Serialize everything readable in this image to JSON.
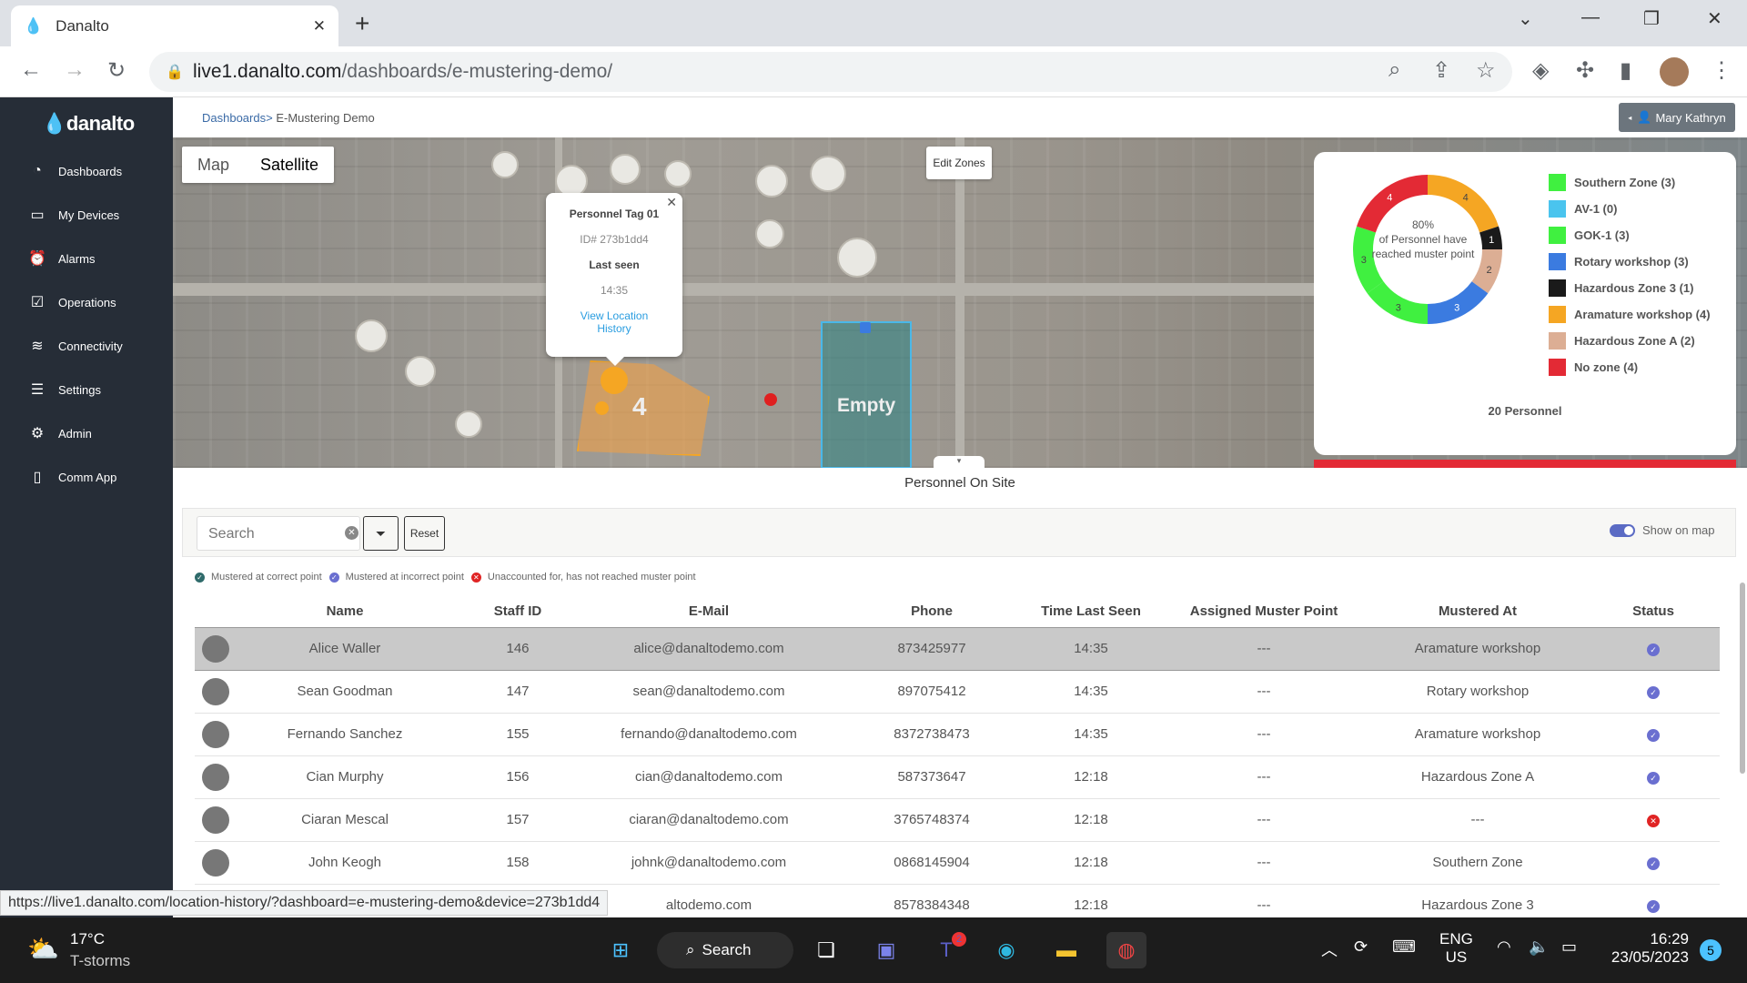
{
  "browser": {
    "tab_title": "Danalto",
    "url_host": "live1.danalto.com",
    "url_path": "/dashboards/e-mustering-demo/",
    "status_url": "https://live1.danalto.com/location-history/?dashboard=e-mustering-demo&device=273b1dd4"
  },
  "sidebar": {
    "logo": "danalto",
    "items": [
      {
        "label": "Dashboards",
        "icon": "dashboard-icon"
      },
      {
        "label": "My Devices",
        "icon": "devices-icon"
      },
      {
        "label": "Alarms",
        "icon": "alarm-icon"
      },
      {
        "label": "Operations",
        "icon": "clipboard-icon"
      },
      {
        "label": "Connectivity",
        "icon": "wifi-icon"
      },
      {
        "label": "Settings",
        "icon": "sliders-icon"
      },
      {
        "label": "Admin",
        "icon": "gear-icon"
      },
      {
        "label": "Comm App",
        "icon": "phone-icon"
      }
    ]
  },
  "breadcrumb": {
    "parent": "Dashboards>",
    "current": "E-Mustering Demo"
  },
  "user": {
    "name": "Mary Kathryn"
  },
  "map": {
    "type_map": "Map",
    "type_satellite": "Satellite",
    "edit_zones": "Edit Zones",
    "zone_count": "4",
    "empty_label": "Empty",
    "popup": {
      "title": "Personnel Tag 01",
      "id": "ID# 273b1dd4",
      "last_seen_label": "Last seen",
      "last_seen": "14:35",
      "link": "View Location History"
    }
  },
  "chart_data": {
    "type": "pie",
    "subtype": "donut",
    "center_percent": "80%",
    "center_text": "of Personnel have reached muster point",
    "total": "20 Personnel",
    "categories": [
      "Southern Zone",
      "AV-1",
      "GOK-1",
      "Rotary workshop",
      "Hazardous Zone 3",
      "Aramature workshop",
      "Hazardous Zone A",
      "No zone"
    ],
    "values": [
      3,
      0,
      3,
      3,
      1,
      4,
      2,
      4
    ],
    "legend_labels": [
      "Southern Zone (3)",
      "AV-1 (0)",
      "GOK-1 (3)",
      "Rotary workshop (3)",
      "Hazardous Zone 3 (1)",
      "Aramature workshop (4)",
      "Hazardous Zone A (2)",
      "No zone (4)"
    ],
    "colors": [
      "#40f040",
      "#4ac4ee",
      "#40f040",
      "#3b7be0",
      "#1a1a1a",
      "#f5a623",
      "#dcae94",
      "#e32a35"
    ],
    "draw_order": [
      5,
      4,
      1,
      6,
      3,
      2,
      0,
      7
    ],
    "legend_placement": "right"
  },
  "section_title": "Personnel On Site",
  "toolbar": {
    "search_placeholder": "Search",
    "reset": "Reset",
    "show_on_map": "Show on map",
    "show_on_map_on": true
  },
  "legend": {
    "correct": "Mustered at correct point",
    "incorrect": "Mustered at incorrect point",
    "unaccounted": "Unaccounted for, has not reached muster point",
    "colors": {
      "correct": "#2f6b6b",
      "incorrect": "#6a6fd0",
      "unaccounted": "#e02424"
    }
  },
  "table": {
    "headers": [
      "Name",
      "Staff ID",
      "E-Mail",
      "Phone",
      "Time Last Seen",
      "Assigned Muster Point",
      "Mustered At",
      "Status"
    ],
    "rows": [
      [
        "Alice Waller",
        "146",
        "alice@danaltodemo.com",
        "873425977",
        "14:35",
        "---",
        "Aramature workshop",
        "incorrect"
      ],
      [
        "Sean Goodman",
        "147",
        "sean@danaltodemo.com",
        "897075412",
        "14:35",
        "---",
        "Rotary workshop",
        "incorrect"
      ],
      [
        "Fernando Sanchez",
        "155",
        "fernando@danaltodemo.com",
        "8372738473",
        "14:35",
        "---",
        "Aramature workshop",
        "incorrect"
      ],
      [
        "Cian Murphy",
        "156",
        "cian@danaltodemo.com",
        "587373647",
        "12:18",
        "---",
        "Hazardous Zone A",
        "incorrect"
      ],
      [
        "Ciaran Mescal",
        "157",
        "ciaran@danaltodemo.com",
        "3765748374",
        "12:18",
        "---",
        "---",
        "unaccounted"
      ],
      [
        "John Keogh",
        "158",
        "johnk@danaltodemo.com",
        "0868145904",
        "12:18",
        "---",
        "Southern Zone",
        "incorrect"
      ],
      [
        "",
        "",
        "altodemo.com",
        "8578384348",
        "12:18",
        "---",
        "Hazardous Zone 3",
        "incorrect"
      ]
    ]
  },
  "taskbar": {
    "temp": "17°C",
    "weather": "T-storms",
    "search": "Search",
    "teams_badge": "2",
    "lang1": "ENG",
    "lang2": "US",
    "time": "16:29",
    "date": "23/05/2023",
    "notif": "5"
  }
}
